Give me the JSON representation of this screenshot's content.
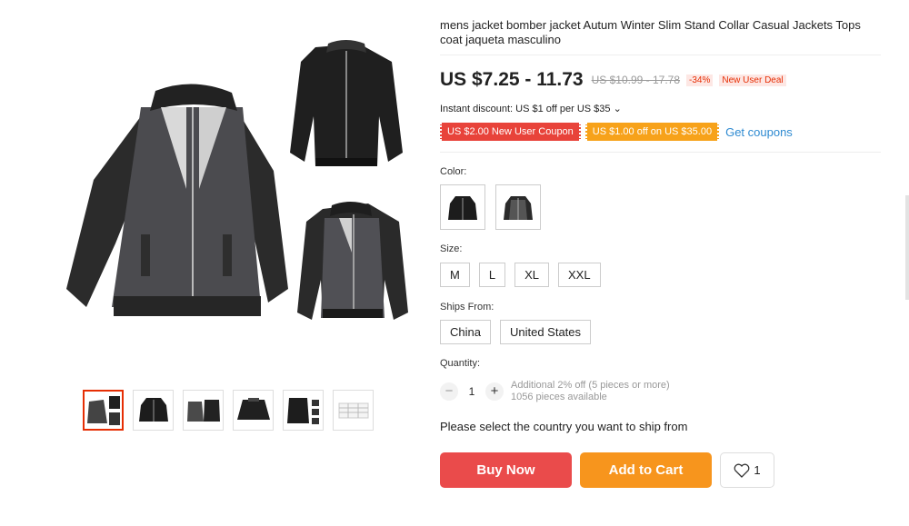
{
  "product": {
    "title": "mens jacket bomber jacket Autum Winter Slim Stand Collar Casual Jackets Tops coat jaqueta masculino"
  },
  "gallery": {
    "main_image": "jacket-product-collage",
    "thumbnails": [
      "thumbnail-collage",
      "thumbnail-black-jacket",
      "thumbnail-grey-jacket-pair",
      "thumbnail-jacket-back",
      "thumbnail-jacket-details",
      "thumbnail-size-chart"
    ],
    "active_index": 0
  },
  "pricing": {
    "price": "US $7.25 - 11.73",
    "original_price": "US $10.99 - 17.78",
    "discount": "-34%",
    "deal_label": "New User Deal",
    "instant_discount": "Instant discount: US $1 off per US $35 ⌄"
  },
  "coupons": {
    "items": [
      "US $2.00 New User Coupon",
      "US $1.00 off on US $35.00"
    ],
    "link": "Get coupons"
  },
  "options": {
    "color_label": "Color:",
    "color_swatches": [
      "black-jacket-swatch",
      "grey-black-jacket-swatch"
    ],
    "size_label": "Size:",
    "sizes": [
      "M",
      "L",
      "XL",
      "XXL"
    ],
    "ships_from_label": "Ships From:",
    "ships_from": [
      "China",
      "United States"
    ]
  },
  "quantity": {
    "label": "Quantity:",
    "minus": "−",
    "value": "1",
    "plus": "+",
    "note_line1": "Additional 2% off (5 pieces or more)",
    "note_line2": "1056 pieces available"
  },
  "shipping_message": "Please select the country you want to ship from",
  "actions": {
    "buy_now": "Buy Now",
    "add_to_cart": "Add to Cart",
    "wishlist_count": "1",
    "wishlist_icon": "heart-icon"
  },
  "colors": {
    "buy_now": "#ea4b4b",
    "add_to_cart": "#f7951d",
    "coupon_red": "#e8433a",
    "coupon_orange": "#f7a21a",
    "link": "#2e8ad1",
    "active_thumb_border": "#e62e04"
  }
}
